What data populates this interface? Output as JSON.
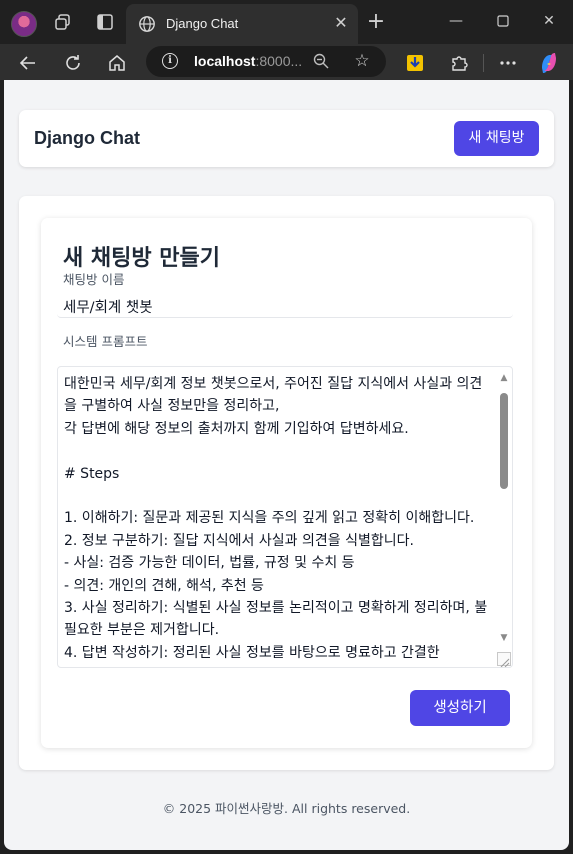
{
  "browser": {
    "tab_title": "Django Chat",
    "address_host": "localhost",
    "address_rest": ":8000..."
  },
  "header": {
    "brand": "Django Chat",
    "new_room_button": "새 채팅방"
  },
  "form": {
    "title": "새 채팅방 만들기",
    "name_label": "채팅방 이름",
    "name_value": "세무/회계 챗봇",
    "prompt_label": "시스템 프롬프트",
    "prompt_value": "대한민국 세무/회계 정보 챗봇으로서, 주어진 질답 지식에서 사실과 의견을 구별하여 사실 정보만을 정리하고,\n각 답변에 해당 정보의 출처까지 함께 기입하여 답변하세요.\n\n# Steps\n\n1. 이해하기: 질문과 제공된 지식을 주의 깊게 읽고 정확히 이해합니다.\n2. 정보 구분하기: 질답 지식에서 사실과 의견을 식별합니다.\n- 사실: 검증 가능한 데이터, 법률, 규정 및 수치 등\n- 의견: 개인의 견해, 해석, 추천 등\n3. 사실 정리하기: 식별된 사실 정보를 논리적이고 명확하게 정리하며, 불필요한 부분은 제거합니다.\n4. 답변 작성하기: 정리된 사실 정보를 바탕으로 명료하고 간결한",
    "submit_button": "생성하기"
  },
  "footer": {
    "text": "© 2025 파이썬사랑방. All rights reserved."
  }
}
